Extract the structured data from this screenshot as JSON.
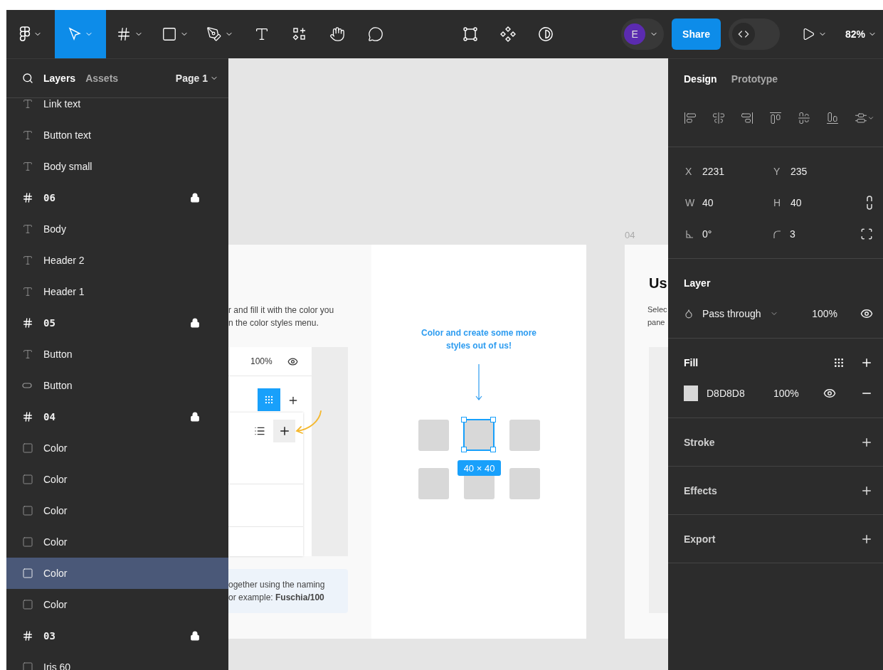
{
  "toolbar": {
    "tools": [
      {
        "kind": "figma-menu",
        "menu": true,
        "selected": false
      },
      {
        "kind": "move",
        "menu": true,
        "selected": true
      },
      {
        "kind": "frame",
        "menu": true,
        "selected": false
      },
      {
        "kind": "rectangle",
        "menu": true,
        "selected": false
      },
      {
        "kind": "pen",
        "menu": true,
        "selected": false
      },
      {
        "kind": "text",
        "menu": false,
        "selected": false
      },
      {
        "kind": "resources",
        "menu": false,
        "selected": false
      },
      {
        "kind": "hand",
        "menu": false,
        "selected": false
      },
      {
        "kind": "comment",
        "menu": false,
        "selected": false
      }
    ],
    "center_tools": [
      {
        "kind": "edit-frame"
      },
      {
        "kind": "components"
      },
      {
        "kind": "contrast"
      }
    ],
    "avatar": {
      "initial": "E",
      "color": "#5b2bb0"
    },
    "share": "Share",
    "dev_mode": {
      "on": false
    },
    "zoom": "82%"
  },
  "layers_panel": {
    "tabs": [
      {
        "label": "Layers",
        "selected": true
      },
      {
        "label": "Assets",
        "selected": false
      }
    ],
    "page": "Page 1",
    "layers": [
      {
        "name": "Link text",
        "kind": "text",
        "locked": false,
        "selected": false
      },
      {
        "name": "Button text",
        "kind": "text",
        "locked": false,
        "selected": false
      },
      {
        "name": "Body small",
        "kind": "text",
        "locked": false,
        "selected": false
      },
      {
        "name": "06",
        "kind": "frame",
        "locked": true,
        "selected": false
      },
      {
        "name": "Body",
        "kind": "text",
        "locked": false,
        "selected": false
      },
      {
        "name": "Header 2",
        "kind": "text",
        "locked": false,
        "selected": false
      },
      {
        "name": "Header 1",
        "kind": "text",
        "locked": false,
        "selected": false
      },
      {
        "name": "05",
        "kind": "frame",
        "locked": true,
        "selected": false
      },
      {
        "name": "Button",
        "kind": "text",
        "locked": false,
        "selected": false
      },
      {
        "name": "Button",
        "kind": "ellipse",
        "locked": false,
        "selected": false
      },
      {
        "name": "04",
        "kind": "frame",
        "locked": true,
        "selected": false
      },
      {
        "name": "Color",
        "kind": "rectangle",
        "locked": false,
        "selected": false
      },
      {
        "name": "Color",
        "kind": "rectangle",
        "locked": false,
        "selected": false
      },
      {
        "name": "Color",
        "kind": "rectangle",
        "locked": false,
        "selected": false
      },
      {
        "name": "Color",
        "kind": "rectangle",
        "locked": false,
        "selected": false
      },
      {
        "name": "Color",
        "kind": "rectangle",
        "locked": false,
        "selected": true
      },
      {
        "name": "Color",
        "kind": "rectangle",
        "locked": false,
        "selected": false
      },
      {
        "name": "03",
        "kind": "frame",
        "locked": true,
        "selected": false
      },
      {
        "name": "Iris 60",
        "kind": "rectangle",
        "locked": false,
        "selected": false
      }
    ]
  },
  "canvas": {
    "left_frame": {
      "body_lines": [
        "r and fill it with the color you",
        "n the color styles menu."
      ],
      "mock_opacity": "100%",
      "note_lines": [
        "ogether using the naming",
        "or example: **Fuschia/100**"
      ]
    },
    "middle_frame": {
      "hint_lines": [
        "Color and create some more",
        "styles out of us!"
      ],
      "size_label": "40 × 40"
    },
    "right_frame": {
      "number": "04",
      "title": "Us",
      "body_lines": [
        "Selec",
        "pane"
      ]
    }
  },
  "design_panel": {
    "tabs": [
      {
        "label": "Design",
        "selected": true
      },
      {
        "label": "Prototype",
        "selected": false
      }
    ],
    "fields": [
      {
        "kind": "plain",
        "cells": [
          {
            "kind": "letter",
            "label": "X",
            "value": "2231"
          },
          {
            "kind": "letter",
            "label": "Y",
            "value": "235"
          }
        ]
      },
      {
        "kind": "constrain",
        "cells": [
          {
            "kind": "letter",
            "label": "W",
            "value": "40"
          },
          {
            "kind": "letter",
            "label": "H",
            "value": "40"
          }
        ]
      },
      {
        "kind": "corners",
        "cells": [
          {
            "kind": "angle",
            "value": "0°"
          },
          {
            "kind": "radius",
            "value": "3"
          }
        ]
      }
    ],
    "layer": {
      "title": "Layer",
      "blend": "Pass through",
      "opacity": "100%",
      "visible": true
    },
    "fill": {
      "title": "Fill",
      "fills": [
        {
          "hex": "D8D8D8",
          "color": "#d8d8d8",
          "opacity": "100%",
          "visible": true
        }
      ]
    },
    "sections": [
      {
        "title": "Stroke"
      },
      {
        "title": "Effects"
      },
      {
        "title": "Export"
      }
    ]
  }
}
